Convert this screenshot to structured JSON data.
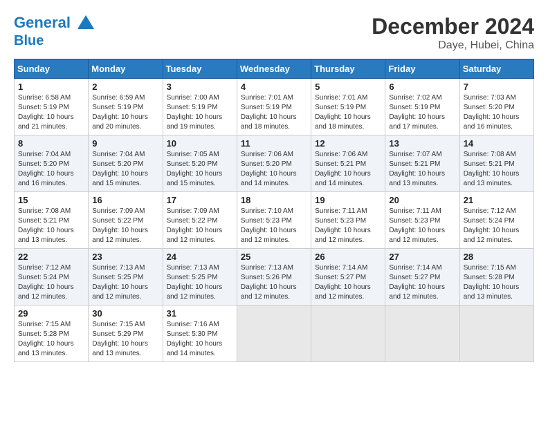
{
  "header": {
    "logo_line1": "General",
    "logo_line2": "Blue",
    "month": "December 2024",
    "location": "Daye, Hubei, China"
  },
  "weekdays": [
    "Sunday",
    "Monday",
    "Tuesday",
    "Wednesday",
    "Thursday",
    "Friday",
    "Saturday"
  ],
  "weeks": [
    [
      {
        "day": "1",
        "info": "Sunrise: 6:58 AM\nSunset: 5:19 PM\nDaylight: 10 hours\nand 21 minutes."
      },
      {
        "day": "2",
        "info": "Sunrise: 6:59 AM\nSunset: 5:19 PM\nDaylight: 10 hours\nand 20 minutes."
      },
      {
        "day": "3",
        "info": "Sunrise: 7:00 AM\nSunset: 5:19 PM\nDaylight: 10 hours\nand 19 minutes."
      },
      {
        "day": "4",
        "info": "Sunrise: 7:01 AM\nSunset: 5:19 PM\nDaylight: 10 hours\nand 18 minutes."
      },
      {
        "day": "5",
        "info": "Sunrise: 7:01 AM\nSunset: 5:19 PM\nDaylight: 10 hours\nand 18 minutes."
      },
      {
        "day": "6",
        "info": "Sunrise: 7:02 AM\nSunset: 5:19 PM\nDaylight: 10 hours\nand 17 minutes."
      },
      {
        "day": "7",
        "info": "Sunrise: 7:03 AM\nSunset: 5:20 PM\nDaylight: 10 hours\nand 16 minutes."
      }
    ],
    [
      {
        "day": "8",
        "info": "Sunrise: 7:04 AM\nSunset: 5:20 PM\nDaylight: 10 hours\nand 16 minutes."
      },
      {
        "day": "9",
        "info": "Sunrise: 7:04 AM\nSunset: 5:20 PM\nDaylight: 10 hours\nand 15 minutes."
      },
      {
        "day": "10",
        "info": "Sunrise: 7:05 AM\nSunset: 5:20 PM\nDaylight: 10 hours\nand 15 minutes."
      },
      {
        "day": "11",
        "info": "Sunrise: 7:06 AM\nSunset: 5:20 PM\nDaylight: 10 hours\nand 14 minutes."
      },
      {
        "day": "12",
        "info": "Sunrise: 7:06 AM\nSunset: 5:21 PM\nDaylight: 10 hours\nand 14 minutes."
      },
      {
        "day": "13",
        "info": "Sunrise: 7:07 AM\nSunset: 5:21 PM\nDaylight: 10 hours\nand 13 minutes."
      },
      {
        "day": "14",
        "info": "Sunrise: 7:08 AM\nSunset: 5:21 PM\nDaylight: 10 hours\nand 13 minutes."
      }
    ],
    [
      {
        "day": "15",
        "info": "Sunrise: 7:08 AM\nSunset: 5:21 PM\nDaylight: 10 hours\nand 13 minutes."
      },
      {
        "day": "16",
        "info": "Sunrise: 7:09 AM\nSunset: 5:22 PM\nDaylight: 10 hours\nand 12 minutes."
      },
      {
        "day": "17",
        "info": "Sunrise: 7:09 AM\nSunset: 5:22 PM\nDaylight: 10 hours\nand 12 minutes."
      },
      {
        "day": "18",
        "info": "Sunrise: 7:10 AM\nSunset: 5:23 PM\nDaylight: 10 hours\nand 12 minutes."
      },
      {
        "day": "19",
        "info": "Sunrise: 7:11 AM\nSunset: 5:23 PM\nDaylight: 10 hours\nand 12 minutes."
      },
      {
        "day": "20",
        "info": "Sunrise: 7:11 AM\nSunset: 5:23 PM\nDaylight: 10 hours\nand 12 minutes."
      },
      {
        "day": "21",
        "info": "Sunrise: 7:12 AM\nSunset: 5:24 PM\nDaylight: 10 hours\nand 12 minutes."
      }
    ],
    [
      {
        "day": "22",
        "info": "Sunrise: 7:12 AM\nSunset: 5:24 PM\nDaylight: 10 hours\nand 12 minutes."
      },
      {
        "day": "23",
        "info": "Sunrise: 7:13 AM\nSunset: 5:25 PM\nDaylight: 10 hours\nand 12 minutes."
      },
      {
        "day": "24",
        "info": "Sunrise: 7:13 AM\nSunset: 5:25 PM\nDaylight: 10 hours\nand 12 minutes."
      },
      {
        "day": "25",
        "info": "Sunrise: 7:13 AM\nSunset: 5:26 PM\nDaylight: 10 hours\nand 12 minutes."
      },
      {
        "day": "26",
        "info": "Sunrise: 7:14 AM\nSunset: 5:27 PM\nDaylight: 10 hours\nand 12 minutes."
      },
      {
        "day": "27",
        "info": "Sunrise: 7:14 AM\nSunset: 5:27 PM\nDaylight: 10 hours\nand 12 minutes."
      },
      {
        "day": "28",
        "info": "Sunrise: 7:15 AM\nSunset: 5:28 PM\nDaylight: 10 hours\nand 13 minutes."
      }
    ],
    [
      {
        "day": "29",
        "info": "Sunrise: 7:15 AM\nSunset: 5:28 PM\nDaylight: 10 hours\nand 13 minutes."
      },
      {
        "day": "30",
        "info": "Sunrise: 7:15 AM\nSunset: 5:29 PM\nDaylight: 10 hours\nand 13 minutes."
      },
      {
        "day": "31",
        "info": "Sunrise: 7:16 AM\nSunset: 5:30 PM\nDaylight: 10 hours\nand 14 minutes."
      },
      {
        "day": "",
        "info": ""
      },
      {
        "day": "",
        "info": ""
      },
      {
        "day": "",
        "info": ""
      },
      {
        "day": "",
        "info": ""
      }
    ]
  ]
}
